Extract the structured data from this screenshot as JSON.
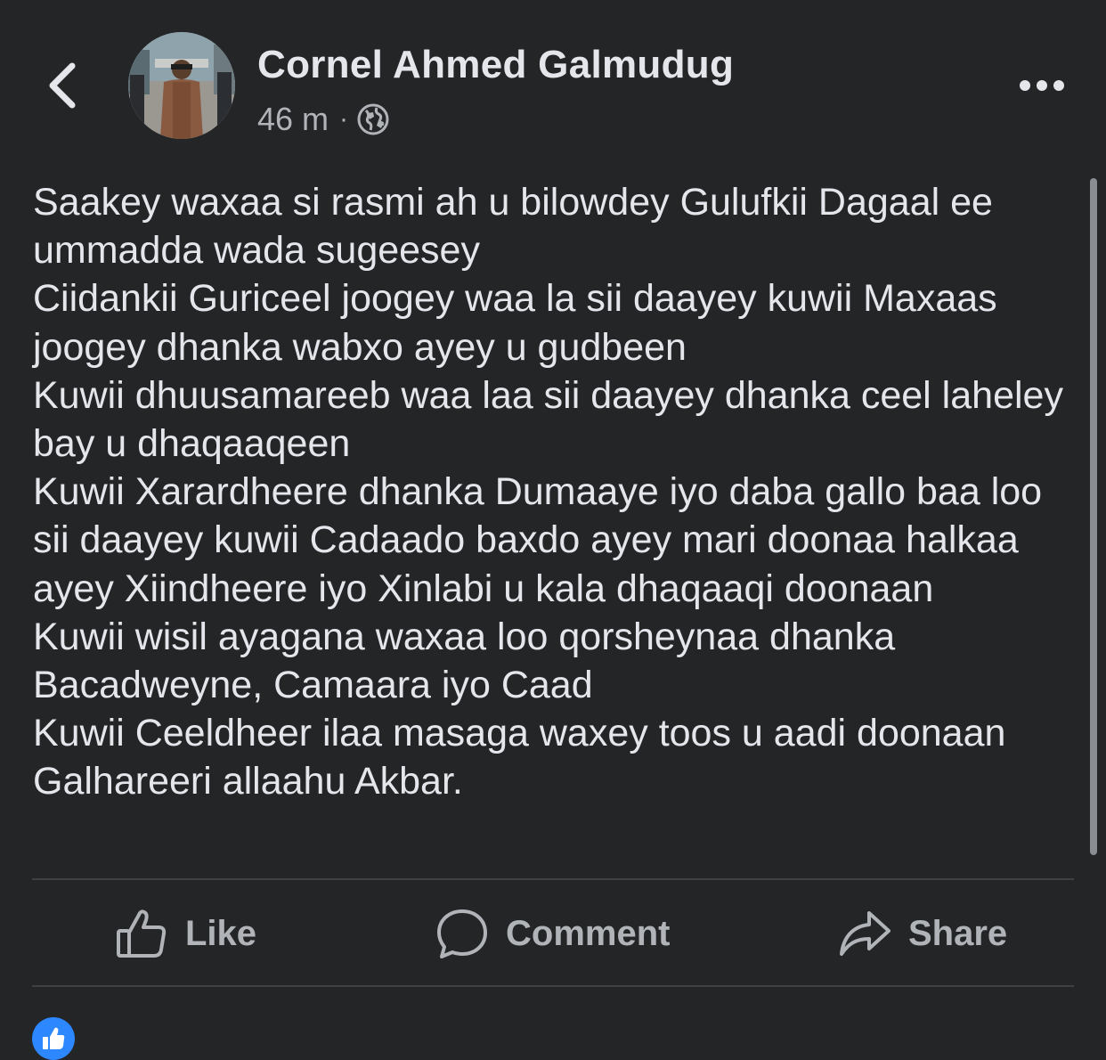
{
  "header": {
    "back_icon": "chevron-left-icon",
    "author": "Cornel Ahmed Galmudug",
    "time": "46 m",
    "separator": "·",
    "audience_icon": "globe-icon",
    "more_icon": "more-horizontal-icon"
  },
  "post": {
    "lines": [
      "Saakey waxaa si rasmi ah u bilowdey Gulufkii Dagaal ee ummadda wada sugeesey",
      "Ciidankii Guriceel joogey waa la sii daayey kuwii Maxaas joogey dhanka wabxo ayey u gudbeen",
      "Kuwii dhuusamareeb waa laa sii daayey dhanka ceel laheley bay u dhaqaaqeen",
      "Kuwii Xarardheere dhanka Dumaaye iyo daba gallo baa loo sii daayey kuwii Cadaado baxdo ayey mari doonaa halkaa ayey Xiindheere iyo Xinlabi u kala dhaqaaqi doonaan",
      "Kuwii wisil ayagana waxaa loo qorsheynaa dhanka Bacadweyne, Camaara iyo Caad",
      "Kuwii Ceeldheer ilaa masaga waxey toos u aadi doonaan Galhareeri allaahu Akbar."
    ]
  },
  "actions": {
    "like": "Like",
    "comment": "Comment",
    "share": "Share"
  },
  "colors": {
    "background": "#242526",
    "text_primary": "#e4e6eb",
    "text_secondary": "#b0b3b8",
    "divider": "#3e4042",
    "like_blue": "#2d88ff"
  }
}
